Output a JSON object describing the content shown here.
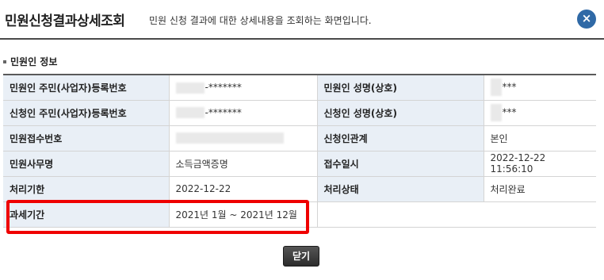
{
  "header": {
    "title": "민원신청결과상세조회",
    "subtitle": "민원 신청 결과에 대한 상세내용을 조회하는 화면입니다.",
    "close_icon": "×"
  },
  "section": {
    "title": "민원인 정보"
  },
  "rows": [
    {
      "label1": "민원인 주민(사업자)등록번호",
      "value1": "-*******",
      "label2": "민원인 성명(상호)",
      "value2": "***"
    },
    {
      "label1": "신청인 주민(사업자)등록번호",
      "value1": "-*******",
      "label2": "신청인 성명(상호)",
      "value2": "***"
    },
    {
      "label1": "민원접수번호",
      "value1": "",
      "label2": "신청인관계",
      "value2": "본인"
    },
    {
      "label1": "민원사무명",
      "value1": "소득금액증명",
      "label2": "접수일시",
      "value2": "2022-12-22 11:56:10"
    },
    {
      "label1": "처리기한",
      "value1": "2022-12-22",
      "label2": "처리상태",
      "value2": "처리완료"
    },
    {
      "label1": "과세기간",
      "value1": "2021년 1월 ~ 2021년 12월"
    }
  ],
  "buttons": {
    "close_label": "닫기"
  },
  "colors": {
    "label_bg": "#e9eff6",
    "accent": "#2f69a6",
    "highlight": "#ef0000"
  }
}
